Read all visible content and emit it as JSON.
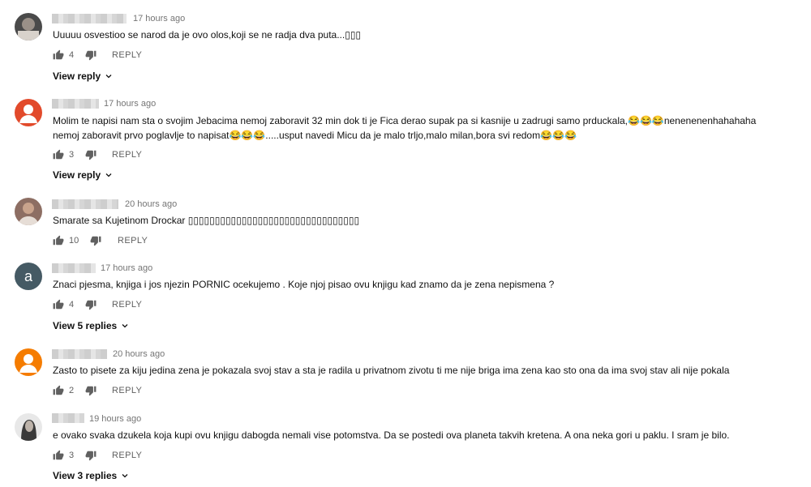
{
  "comments": [
    {
      "time": "17 hours ago",
      "text": "Uuuuu osvestioo se narod da je ovo olos,koji se ne radja dva puta...▯▯▯",
      "likes": "4",
      "reply_label": "REPLY",
      "view_replies": "View reply",
      "avatar_color": "#6b6b6b"
    },
    {
      "time": "17 hours ago",
      "text": "Molim te napisi nam sta o svojim Jebacima nemoj zaboravit 32 min dok ti je Fica derao supak pa si kasnije u zadrugi samo prduckala,😂😂😂nenenenenhahahaha nemoj zaboravit prvo poglavlje to napisat😂😂😂.....usput navedi Micu da je malo trljo,malo milan,bora svi redom😂😂😂",
      "likes": "3",
      "reply_label": "REPLY",
      "view_replies": "View reply",
      "avatar_color": "#e24a2b"
    },
    {
      "time": "20 hours ago",
      "text": "Smarate sa Kujetinom Drockar ▯▯▯▯▯▯▯▯▯▯▯▯▯▯▯▯▯▯▯▯▯▯▯▯▯▯▯▯▯▯▯▯",
      "likes": "10",
      "reply_label": "REPLY",
      "view_replies": "",
      "avatar_color": "#8d6e63"
    },
    {
      "time": "17 hours ago",
      "text": "Znaci pjesma, knjiga i jos njezin PORNIC ocekujemo . Koje njoj pisao ovu knjigu kad znamo da je zena nepismena ?",
      "likes": "4",
      "reply_label": "REPLY",
      "view_replies": "View 5 replies",
      "avatar_color": "#455a64",
      "avatar_letter": "a"
    },
    {
      "time": "20 hours ago",
      "text": "Zasto to pisete za kiju jedina zena je pokazala svoj stav a sta je radila u privatnom zivotu ti me nije briga ima zena kao sto ona da ima svoj stav ali nije pokala",
      "likes": "2",
      "reply_label": "REPLY",
      "view_replies": "",
      "avatar_color": "#f57c00"
    },
    {
      "time": "19 hours ago",
      "text": "e ovako svaka dzukela koja kupi ovu knjigu dabogda nemali vise potomstva. Da se postedi ova planeta takvih kretena. A ona neka gori u paklu. I sram je bilo.",
      "likes": "3",
      "reply_label": "REPLY",
      "view_replies": "View 3 replies",
      "avatar_color": "#7a7a7a"
    }
  ]
}
